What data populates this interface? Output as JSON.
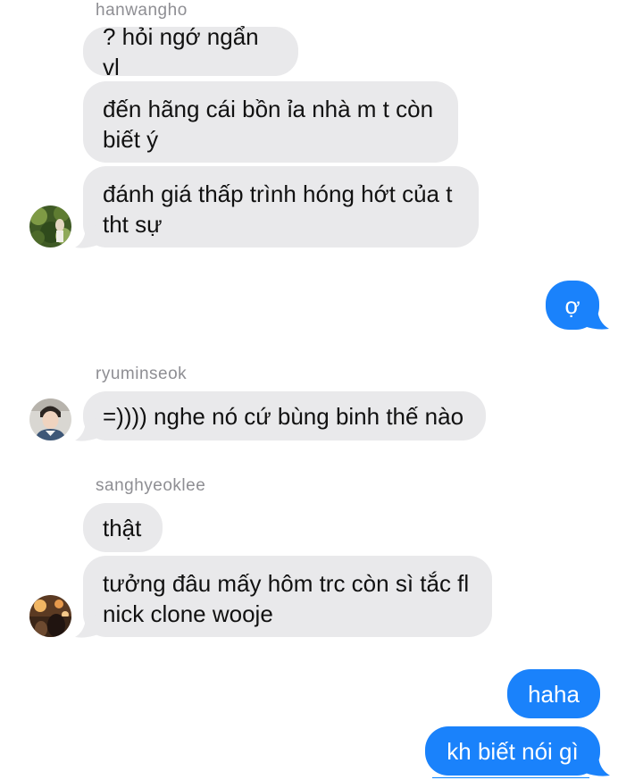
{
  "senders": {
    "first": "hanwangho",
    "second": "ryuminseok",
    "third": "sanghyeoklee"
  },
  "messages": {
    "m1": "? hỏi ngớ ngẩn vl",
    "m2_line1": "đến hãng cái bồn ỉa nhà m t còn",
    "m2_line2": "biết ý",
    "m3_line1": "đánh giá thấp trình hóng hớt của t",
    "m3_line2": "tht sự",
    "m4": "ợ",
    "m5": "=)))) nghe nó cứ bùng binh thế nào",
    "m6": "thật",
    "m7_line1": "tưởng đâu mấy hôm trc còn sì tắc fl",
    "m7_line2": "nick clone wooje",
    "m8": "haha",
    "m9": "kh biết nói gì"
  },
  "colors": {
    "incoming_bubble": "#e9e9eb",
    "outgoing_bubble": "#1a82fb",
    "sender_name": "#8e8e93"
  },
  "avatars": [
    "avatar-green-foliage",
    "avatar-boy-portrait",
    "avatar-warm-lights"
  ]
}
